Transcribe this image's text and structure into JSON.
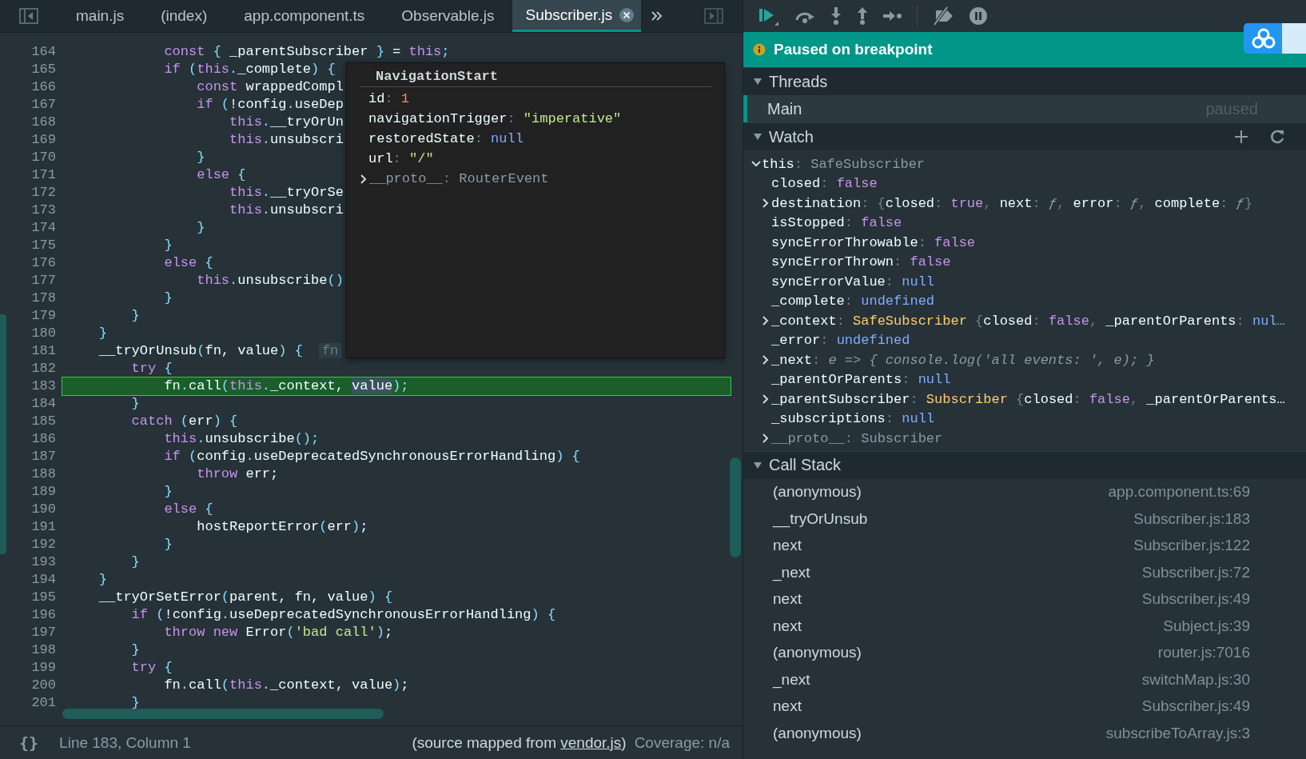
{
  "tabs": [
    {
      "label": "main.js",
      "selected": false
    },
    {
      "label": "(index)",
      "selected": false
    },
    {
      "label": "app.component.ts",
      "selected": false
    },
    {
      "label": "Observable.js",
      "selected": false
    },
    {
      "label": "Subscriber.js",
      "selected": true
    }
  ],
  "editor": {
    "lines": [
      {
        "number": "164",
        "current": false,
        "tokens": [
          {
            "kind": "keyword",
            "text": "            const"
          },
          {
            "kind": "punct",
            "text": " {"
          },
          {
            "kind": "plain",
            "text": " _parentSubscriber "
          },
          {
            "kind": "punct",
            "text": "}"
          },
          {
            "kind": "plain",
            "text": " = "
          },
          {
            "kind": "keyword",
            "text": "this"
          },
          {
            "kind": "punct",
            "text": ";"
          }
        ]
      },
      {
        "number": "165",
        "current": false,
        "tokens": [
          {
            "kind": "keyword",
            "text": "            if"
          },
          {
            "kind": "punct",
            "text": " ("
          },
          {
            "kind": "keyword",
            "text": "this"
          },
          {
            "kind": "punct",
            "text": "."
          },
          {
            "kind": "plain",
            "text": "_complete"
          },
          {
            "kind": "punct",
            "text": ") {"
          }
        ]
      },
      {
        "number": "166",
        "current": false,
        "tokens": [
          {
            "kind": "keyword",
            "text": "                const"
          },
          {
            "kind": "plain",
            "text": " wrappedCompl"
          }
        ]
      },
      {
        "number": "167",
        "current": false,
        "tokens": [
          {
            "kind": "keyword",
            "text": "                if"
          },
          {
            "kind": "punct",
            "text": " ("
          },
          {
            "kind": "plain",
            "text": "!config"
          },
          {
            "kind": "punct",
            "text": "."
          },
          {
            "kind": "plain",
            "text": "useDep"
          }
        ]
      },
      {
        "number": "168",
        "current": false,
        "tokens": [
          {
            "kind": "keyword",
            "text": "                    this"
          },
          {
            "kind": "punct",
            "text": "."
          },
          {
            "kind": "plain",
            "text": "__tryOrUn"
          }
        ]
      },
      {
        "number": "169",
        "current": false,
        "tokens": [
          {
            "kind": "keyword",
            "text": "                    this"
          },
          {
            "kind": "punct",
            "text": "."
          },
          {
            "kind": "plain",
            "text": "unsubscri"
          }
        ]
      },
      {
        "number": "170",
        "current": false,
        "tokens": [
          {
            "kind": "punct",
            "text": "                }"
          }
        ]
      },
      {
        "number": "171",
        "current": false,
        "tokens": [
          {
            "kind": "keyword",
            "text": "                else"
          },
          {
            "kind": "punct",
            "text": " {"
          }
        ]
      },
      {
        "number": "172",
        "current": false,
        "tokens": [
          {
            "kind": "keyword",
            "text": "                    this"
          },
          {
            "kind": "punct",
            "text": "."
          },
          {
            "kind": "plain",
            "text": "__tryOrSe"
          }
        ]
      },
      {
        "number": "173",
        "current": false,
        "tokens": [
          {
            "kind": "keyword",
            "text": "                    this"
          },
          {
            "kind": "punct",
            "text": "."
          },
          {
            "kind": "plain",
            "text": "unsubscri"
          }
        ]
      },
      {
        "number": "174",
        "current": false,
        "tokens": [
          {
            "kind": "punct",
            "text": "                }"
          }
        ]
      },
      {
        "number": "175",
        "current": false,
        "tokens": [
          {
            "kind": "punct",
            "text": "            }"
          }
        ]
      },
      {
        "number": "176",
        "current": false,
        "tokens": [
          {
            "kind": "keyword",
            "text": "            else"
          },
          {
            "kind": "punct",
            "text": " {"
          }
        ]
      },
      {
        "number": "177",
        "current": false,
        "tokens": [
          {
            "kind": "keyword",
            "text": "                this"
          },
          {
            "kind": "punct",
            "text": "."
          },
          {
            "kind": "plain",
            "text": "unsubscribe"
          },
          {
            "kind": "punct",
            "text": "()"
          }
        ]
      },
      {
        "number": "178",
        "current": false,
        "tokens": [
          {
            "kind": "punct",
            "text": "            }"
          }
        ]
      },
      {
        "number": "179",
        "current": false,
        "tokens": [
          {
            "kind": "punct",
            "text": "        }"
          }
        ]
      },
      {
        "number": "180",
        "current": false,
        "tokens": [
          {
            "kind": "punct",
            "text": "    }"
          }
        ]
      },
      {
        "number": "181",
        "current": false,
        "tokens": [
          {
            "kind": "plain",
            "text": "    __tryOrUnsub"
          },
          {
            "kind": "punct",
            "text": "("
          },
          {
            "kind": "plain",
            "text": "fn, value"
          },
          {
            "kind": "punct",
            "text": ") {"
          },
          {
            "kind": "hint",
            "text": "fn"
          }
        ]
      },
      {
        "number": "182",
        "current": false,
        "tokens": [
          {
            "kind": "keyword",
            "text": "        try"
          },
          {
            "kind": "punct",
            "text": " {"
          }
        ]
      },
      {
        "number": "183",
        "current": true,
        "tokens": [
          {
            "kind": "plain",
            "text": "            fn"
          },
          {
            "kind": "punct",
            "text": "."
          },
          {
            "kind": "plain",
            "text": "call"
          },
          {
            "kind": "punct",
            "text": "("
          },
          {
            "kind": "keyword",
            "text": "this"
          },
          {
            "kind": "punct",
            "text": "."
          },
          {
            "kind": "plain",
            "text": "_context, "
          },
          {
            "kind": "selection",
            "text": "value"
          },
          {
            "kind": "punct",
            "text": ");"
          }
        ]
      },
      {
        "number": "184",
        "current": false,
        "tokens": [
          {
            "kind": "punct",
            "text": "        }"
          }
        ]
      },
      {
        "number": "185",
        "current": false,
        "tokens": [
          {
            "kind": "keyword",
            "text": "        catch"
          },
          {
            "kind": "punct",
            "text": " ("
          },
          {
            "kind": "plain",
            "text": "err"
          },
          {
            "kind": "punct",
            "text": ") {"
          }
        ]
      },
      {
        "number": "186",
        "current": false,
        "tokens": [
          {
            "kind": "keyword",
            "text": "            this"
          },
          {
            "kind": "punct",
            "text": "."
          },
          {
            "kind": "plain",
            "text": "unsubscribe"
          },
          {
            "kind": "punct",
            "text": "();"
          }
        ]
      },
      {
        "number": "187",
        "current": false,
        "tokens": [
          {
            "kind": "keyword",
            "text": "            if"
          },
          {
            "kind": "punct",
            "text": " ("
          },
          {
            "kind": "plain",
            "text": "config"
          },
          {
            "kind": "punct",
            "text": "."
          },
          {
            "kind": "plain",
            "text": "useDeprecatedSynchronousErrorHandling"
          },
          {
            "kind": "punct",
            "text": ") {"
          }
        ]
      },
      {
        "number": "188",
        "current": false,
        "tokens": [
          {
            "kind": "keyword",
            "text": "                throw"
          },
          {
            "kind": "plain",
            "text": " err;"
          }
        ]
      },
      {
        "number": "189",
        "current": false,
        "tokens": [
          {
            "kind": "punct",
            "text": "            }"
          }
        ]
      },
      {
        "number": "190",
        "current": false,
        "tokens": [
          {
            "kind": "keyword",
            "text": "            else"
          },
          {
            "kind": "punct",
            "text": " {"
          }
        ]
      },
      {
        "number": "191",
        "current": false,
        "tokens": [
          {
            "kind": "plain",
            "text": "                hostReportError"
          },
          {
            "kind": "punct",
            "text": "("
          },
          {
            "kind": "plain",
            "text": "err"
          },
          {
            "kind": "punct",
            "text": ")"
          },
          {
            "kind": "plain",
            "text": ";"
          }
        ]
      },
      {
        "number": "192",
        "current": false,
        "tokens": [
          {
            "kind": "punct",
            "text": "            }"
          }
        ]
      },
      {
        "number": "193",
        "current": false,
        "tokens": [
          {
            "kind": "punct",
            "text": "        }"
          }
        ]
      },
      {
        "number": "194",
        "current": false,
        "tokens": [
          {
            "kind": "punct",
            "text": "    }"
          }
        ]
      },
      {
        "number": "195",
        "current": false,
        "tokens": [
          {
            "kind": "plain",
            "text": "    __tryOrSetError"
          },
          {
            "kind": "punct",
            "text": "("
          },
          {
            "kind": "plain",
            "text": "parent, fn, value"
          },
          {
            "kind": "punct",
            "text": ") {"
          }
        ]
      },
      {
        "number": "196",
        "current": false,
        "tokens": [
          {
            "kind": "keyword",
            "text": "        if"
          },
          {
            "kind": "punct",
            "text": " ("
          },
          {
            "kind": "plain",
            "text": "!config"
          },
          {
            "kind": "punct",
            "text": "."
          },
          {
            "kind": "plain",
            "text": "useDeprecatedSynchronousErrorHandling"
          },
          {
            "kind": "punct",
            "text": ") {"
          }
        ]
      },
      {
        "number": "197",
        "current": false,
        "tokens": [
          {
            "kind": "keyword",
            "text": "            throw new"
          },
          {
            "kind": "plain",
            "text": " Error"
          },
          {
            "kind": "punct",
            "text": "("
          },
          {
            "kind": "string",
            "text": "'bad call'"
          },
          {
            "kind": "punct",
            "text": ")"
          },
          {
            "kind": "plain",
            "text": ";"
          }
        ]
      },
      {
        "number": "198",
        "current": false,
        "tokens": [
          {
            "kind": "punct",
            "text": "        }"
          }
        ]
      },
      {
        "number": "199",
        "current": false,
        "tokens": [
          {
            "kind": "keyword",
            "text": "        try"
          },
          {
            "kind": "punct",
            "text": " {"
          }
        ]
      },
      {
        "number": "200",
        "current": false,
        "tokens": [
          {
            "kind": "plain",
            "text": "            fn"
          },
          {
            "kind": "punct",
            "text": "."
          },
          {
            "kind": "plain",
            "text": "call"
          },
          {
            "kind": "punct",
            "text": "("
          },
          {
            "kind": "keyword",
            "text": "this"
          },
          {
            "kind": "punct",
            "text": "."
          },
          {
            "kind": "plain",
            "text": "_context, value"
          },
          {
            "kind": "punct",
            "text": ")"
          },
          {
            "kind": "plain",
            "text": ";"
          }
        ]
      },
      {
        "number": "201",
        "current": false,
        "tokens": [
          {
            "kind": "punct",
            "text": "        }"
          }
        ]
      }
    ],
    "tooltip": {
      "title": "NavigationStart",
      "props": [
        {
          "name": "id",
          "parts": [
            {
              "kind": "punct",
              "text": ": "
            },
            {
              "kind": "number",
              "text": "1"
            }
          ]
        },
        {
          "name": "navigationTrigger",
          "parts": [
            {
              "kind": "punct",
              "text": ": "
            },
            {
              "kind": "string",
              "text": "\"imperative\""
            }
          ]
        },
        {
          "name": "restoredState",
          "parts": [
            {
              "kind": "punct",
              "text": ": "
            },
            {
              "kind": "null",
              "text": "null"
            }
          ]
        },
        {
          "name": "url",
          "parts": [
            {
              "kind": "punct",
              "text": ": "
            },
            {
              "kind": "string",
              "text": "\"/\""
            }
          ]
        }
      ],
      "proto": {
        "name": "__proto__",
        "expanded": false,
        "parts": [
          {
            "kind": "punct",
            "text": ": "
          },
          {
            "kind": "type",
            "text": "RouterEvent"
          }
        ]
      }
    }
  },
  "status_bar": {
    "format_label": "{}",
    "position": "Line 183, Column 1",
    "source_before": "(source mapped from ",
    "source_link": "vendor.js",
    "source_after": ")",
    "coverage": "Coverage: n/a"
  },
  "debugger": {
    "banner": "Paused on breakpoint",
    "threads": {
      "title": "Threads",
      "expanded": true,
      "items": [
        {
          "name": "Main",
          "status": "paused",
          "selected": true
        }
      ]
    },
    "watch": {
      "title": "Watch",
      "expanded": true,
      "items": [
        {
          "name": "this",
          "expandable": true,
          "expanded": true,
          "parts": [
            {
              "kind": "punct",
              "text": ": "
            },
            {
              "kind": "type",
              "text": "SafeSubscriber"
            }
          ],
          "children": [
            {
              "name": "closed",
              "expandable": false,
              "parts": [
                {
                  "kind": "punct",
                  "text": ": "
                },
                {
                  "kind": "bool",
                  "text": "false"
                }
              ]
            },
            {
              "name": "destination",
              "expandable": true,
              "expanded": false,
              "parts": [
                {
                  "kind": "punct",
                  "text": ": {"
                },
                {
                  "kind": "key",
                  "text": "closed"
                },
                {
                  "kind": "punct",
                  "text": ": "
                },
                {
                  "kind": "bool",
                  "text": "true"
                },
                {
                  "kind": "punct",
                  "text": ", "
                },
                {
                  "kind": "key",
                  "text": "next"
                },
                {
                  "kind": "punct",
                  "text": ": "
                },
                {
                  "kind": "func",
                  "text": "ƒ"
                },
                {
                  "kind": "punct",
                  "text": ", "
                },
                {
                  "kind": "key",
                  "text": "error"
                },
                {
                  "kind": "punct",
                  "text": ": "
                },
                {
                  "kind": "func",
                  "text": "ƒ"
                },
                {
                  "kind": "punct",
                  "text": ", "
                },
                {
                  "kind": "key",
                  "text": "complete"
                },
                {
                  "kind": "punct",
                  "text": ": "
                },
                {
                  "kind": "func",
                  "text": "ƒ"
                },
                {
                  "kind": "punct",
                  "text": "}"
                }
              ]
            },
            {
              "name": "isStopped",
              "expandable": false,
              "parts": [
                {
                  "kind": "punct",
                  "text": ": "
                },
                {
                  "kind": "bool",
                  "text": "false"
                }
              ]
            },
            {
              "name": "syncErrorThrowable",
              "expandable": false,
              "parts": [
                {
                  "kind": "punct",
                  "text": ": "
                },
                {
                  "kind": "bool",
                  "text": "false"
                }
              ]
            },
            {
              "name": "syncErrorThrown",
              "expandable": false,
              "parts": [
                {
                  "kind": "punct",
                  "text": ": "
                },
                {
                  "kind": "bool",
                  "text": "false"
                }
              ]
            },
            {
              "name": "syncErrorValue",
              "expandable": false,
              "parts": [
                {
                  "kind": "punct",
                  "text": ": "
                },
                {
                  "kind": "null",
                  "text": "null"
                }
              ]
            },
            {
              "name": "_complete",
              "expandable": false,
              "parts": [
                {
                  "kind": "punct",
                  "text": ": "
                },
                {
                  "kind": "null",
                  "text": "undefined"
                }
              ]
            },
            {
              "name": "_context",
              "expandable": true,
              "expanded": false,
              "parts": [
                {
                  "kind": "punct",
                  "text": ": "
                },
                {
                  "kind": "class",
                  "text": "SafeSubscriber"
                },
                {
                  "kind": "punct",
                  "text": " {"
                },
                {
                  "kind": "key",
                  "text": "closed"
                },
                {
                  "kind": "punct",
                  "text": ": "
                },
                {
                  "kind": "bool",
                  "text": "false"
                },
                {
                  "kind": "punct",
                  "text": ", "
                },
                {
                  "kind": "key",
                  "text": "_parentOrParents"
                },
                {
                  "kind": "punct",
                  "text": ": "
                },
                {
                  "kind": "null",
                  "text": "nul…"
                }
              ]
            },
            {
              "name": "_error",
              "expandable": false,
              "parts": [
                {
                  "kind": "punct",
                  "text": ": "
                },
                {
                  "kind": "null",
                  "text": "undefined"
                }
              ]
            },
            {
              "name": "_next",
              "expandable": true,
              "expanded": false,
              "parts": [
                {
                  "kind": "punct",
                  "text": ": "
                },
                {
                  "kind": "func",
                  "text": "e => { console.log('all events: ', e); }"
                }
              ]
            },
            {
              "name": "_parentOrParents",
              "expandable": false,
              "parts": [
                {
                  "kind": "punct",
                  "text": ": "
                },
                {
                  "kind": "null",
                  "text": "null"
                }
              ]
            },
            {
              "name": "_parentSubscriber",
              "expandable": true,
              "expanded": false,
              "parts": [
                {
                  "kind": "punct",
                  "text": ": "
                },
                {
                  "kind": "class",
                  "text": "Subscriber"
                },
                {
                  "kind": "punct",
                  "text": " {"
                },
                {
                  "kind": "key",
                  "text": "closed"
                },
                {
                  "kind": "punct",
                  "text": ": "
                },
                {
                  "kind": "bool",
                  "text": "false"
                },
                {
                  "kind": "punct",
                  "text": ", "
                },
                {
                  "kind": "key",
                  "text": "_parentOrParents…"
                }
              ]
            },
            {
              "name": "_subscriptions",
              "expandable": false,
              "parts": [
                {
                  "kind": "punct",
                  "text": ": "
                },
                {
                  "kind": "null",
                  "text": "null"
                }
              ]
            },
            {
              "name": "__proto__",
              "expandable": true,
              "expanded": false,
              "dim": true,
              "parts": [
                {
                  "kind": "punct",
                  "text": ": "
                },
                {
                  "kind": "type",
                  "text": "Subscriber"
                }
              ]
            }
          ]
        }
      ]
    },
    "call_stack": {
      "title": "Call Stack",
      "expanded": true,
      "frames": [
        {
          "name": "(anonymous)",
          "location": "app.component.ts:69"
        },
        {
          "name": "__tryOrUnsub",
          "location": "Subscriber.js:183"
        },
        {
          "name": "next",
          "location": "Subscriber.js:122"
        },
        {
          "name": "_next",
          "location": "Subscriber.js:72"
        },
        {
          "name": "next",
          "location": "Subscriber.js:49"
        },
        {
          "name": "next",
          "location": "Subject.js:39"
        },
        {
          "name": "(anonymous)",
          "location": "router.js:7016"
        },
        {
          "name": "_next",
          "location": "switchMap.js:30"
        },
        {
          "name": "next",
          "location": "Subscriber.js:49"
        },
        {
          "name": "(anonymous)",
          "location": "subscribeToArray.js:3"
        }
      ]
    }
  }
}
